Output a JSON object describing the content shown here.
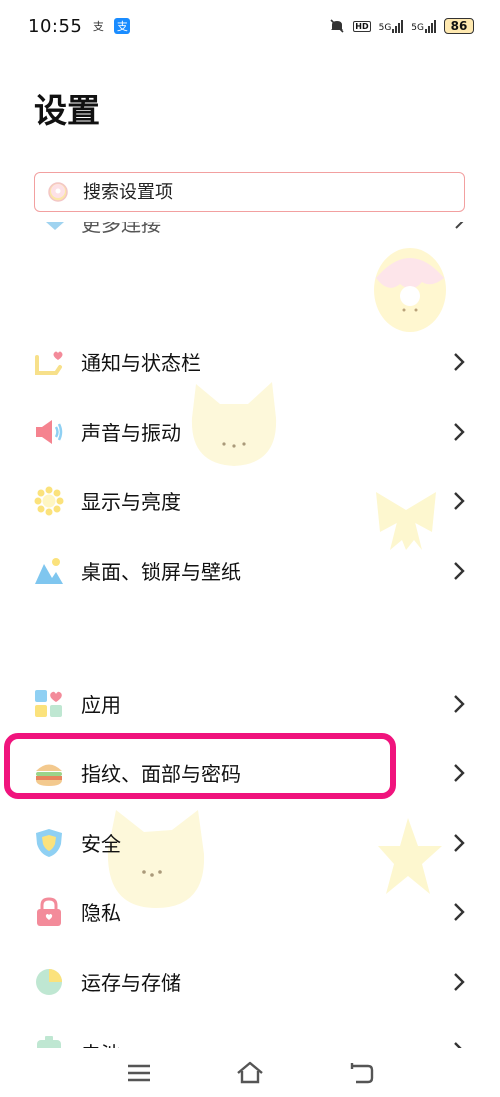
{
  "status_bar": {
    "time": "10:55",
    "notif_icon_1": "支",
    "notif_icon_2": "支",
    "hd_label": "HD",
    "sim1_label": "5G",
    "sim2_label": "5G",
    "battery": "86"
  },
  "page": {
    "title": "设置"
  },
  "search": {
    "placeholder": "搜索设置项"
  },
  "partial_item": {
    "label": "更多连接"
  },
  "settings_items": [
    {
      "label": "通知与状态栏",
      "icon": "notification-icon"
    },
    {
      "label": "声音与振动",
      "icon": "speaker-icon"
    },
    {
      "label": "显示与亮度",
      "icon": "sun-icon"
    },
    {
      "label": "桌面、锁屏与壁纸",
      "icon": "wallpaper-icon"
    },
    {
      "label": "应用",
      "icon": "apps-icon"
    },
    {
      "label": "指纹、面部与密码",
      "icon": "burger-icon"
    },
    {
      "label": "安全",
      "icon": "shield-icon"
    },
    {
      "label": "隐私",
      "icon": "lock-icon"
    },
    {
      "label": "运存与存储",
      "icon": "storage-icon"
    },
    {
      "label": "电池",
      "icon": "battery-icon"
    }
  ],
  "colors": {
    "highlight": "#f0147d",
    "search_border": "#f2a0a0",
    "text": "#111111"
  },
  "nav_bar": {
    "icons": [
      "menu-icon",
      "home-icon",
      "back-icon"
    ]
  }
}
